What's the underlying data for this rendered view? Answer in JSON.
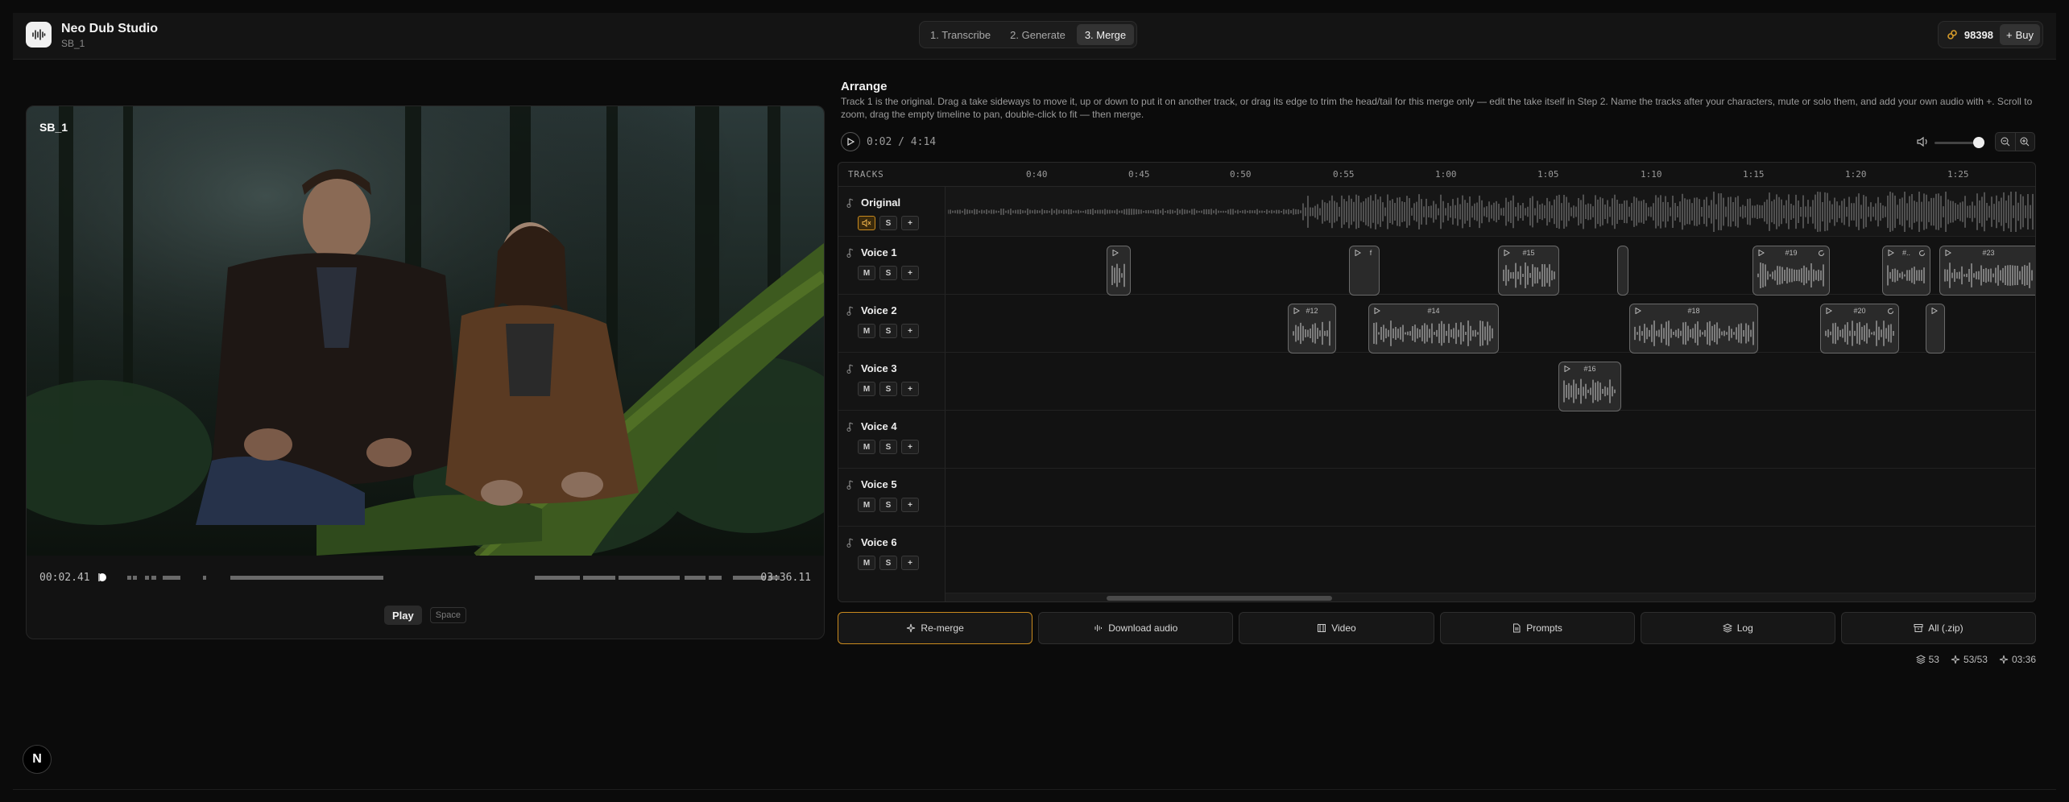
{
  "app": {
    "title": "Neo Dub Studio",
    "subtitle": "SB_1"
  },
  "steps": [
    {
      "label": "1. Transcribe",
      "active": false
    },
    {
      "label": "2. Generate",
      "active": false
    },
    {
      "label": "3. Merge",
      "active": true
    }
  ],
  "credits": {
    "value": "98398",
    "buy_label": "Buy"
  },
  "video": {
    "scene_tag": "SB_1",
    "time_current": "00:02.41",
    "time_total": "03:36.11",
    "play_label": "Play",
    "play_shortcut": "Space"
  },
  "arrange": {
    "title": "Arrange",
    "description": "Track 1 is the original. Drag a take sideways to move it, up or down to put it on another track, or drag its edge to trim the head/tail for this merge only — edit the take itself in Step 2. Name the tracks after your characters, mute or solo them, and add your own audio with +. Scroll to zoom, drag the empty timeline to pan, double-click to fit — then merge.",
    "time_readout": "0:02 / 4:14",
    "volume": 0.9,
    "tracks_label": "TRACKS",
    "ruler": [
      "0:40",
      "0:45",
      "0:50",
      "0:55",
      "1:00",
      "1:05",
      "1:10",
      "1:15",
      "1:20",
      "1:25"
    ],
    "tracks": [
      {
        "name": "Original",
        "mute_label": "",
        "solo_label": "S",
        "add_label": "+",
        "muted": true
      },
      {
        "name": "Voice 1",
        "mute_label": "M",
        "solo_label": "S",
        "add_label": "+",
        "muted": false
      },
      {
        "name": "Voice 2",
        "mute_label": "M",
        "solo_label": "S",
        "add_label": "+",
        "muted": false
      },
      {
        "name": "Voice 3",
        "mute_label": "M",
        "solo_label": "S",
        "add_label": "+",
        "muted": false
      },
      {
        "name": "Voice 4",
        "mute_label": "M",
        "solo_label": "S",
        "add_label": "+",
        "muted": false
      },
      {
        "name": "Voice 5",
        "mute_label": "M",
        "solo_label": "S",
        "add_label": "+",
        "muted": false
      },
      {
        "name": "Voice 6",
        "mute_label": "M",
        "solo_label": "S",
        "add_label": "+",
        "muted": false
      }
    ],
    "clip_labels": {
      "c1a": "",
      "c1b": "f",
      "c1c": "#15",
      "c1d": "",
      "c1e": "#19",
      "c1f": "#..",
      "c1g": "#23",
      "c2a": "#12",
      "c2b": "#14",
      "c2c": "#18",
      "c2d": "#20",
      "c2e": "",
      "c3a": "#16"
    }
  },
  "actions": [
    {
      "label": "Re-merge",
      "icon": "sparkle-icon"
    },
    {
      "label": "Download audio",
      "icon": "waveform-icon"
    },
    {
      "label": "Video",
      "icon": "film-icon"
    },
    {
      "label": "Prompts",
      "icon": "document-icon"
    },
    {
      "label": "Log",
      "icon": "layers-icon"
    },
    {
      "label": "All (.zip)",
      "icon": "archive-icon"
    }
  ],
  "stats": {
    "layers": "53",
    "takes": "53/53",
    "duration": "03:36"
  },
  "badge": "N",
  "colors": {
    "accent": "#c98a1e",
    "background": "#0b0b0b",
    "panel": "#141414"
  }
}
